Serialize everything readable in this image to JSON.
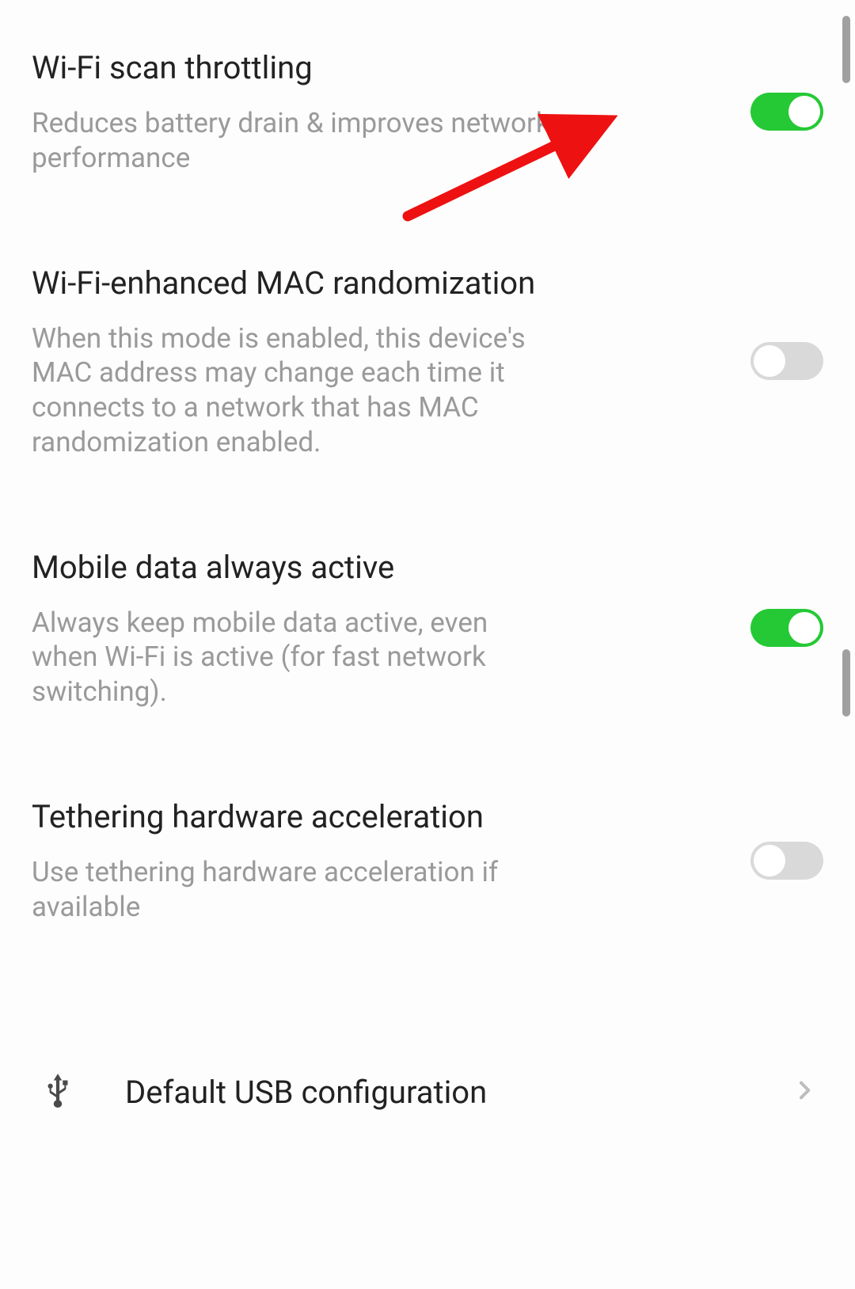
{
  "settings": [
    {
      "title": "Wi-Fi scan throttling",
      "description": "Reduces battery drain & improves network performance",
      "enabled": true
    },
    {
      "title": "Wi-Fi-enhanced MAC randomization",
      "description": "When this mode is enabled, this device's MAC address may change each time it connects to a network that has MAC randomization enabled.",
      "enabled": false
    },
    {
      "title": "Mobile data always active",
      "description": "Always keep mobile data active, even when Wi-Fi is active (for fast network switching).",
      "enabled": true
    },
    {
      "title": "Tethering hardware acceleration",
      "description": "Use tethering hardware acceleration if available",
      "enabled": false
    }
  ],
  "link": {
    "label": "Default USB configuration",
    "icon": "usb-icon"
  },
  "colors": {
    "toggle_on": "#25c935",
    "toggle_off": "#d9d9d9",
    "annotation_arrow": "#ee1111"
  }
}
